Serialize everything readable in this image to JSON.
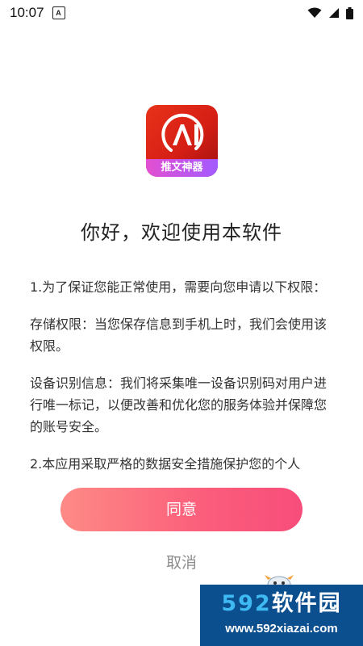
{
  "status_bar": {
    "time": "10:07",
    "notification_icon": "a-icon",
    "icons": [
      "wifi-icon",
      "signal-icon",
      "battery-icon"
    ]
  },
  "app": {
    "logo_text": "AI",
    "logo_label": "推文神器",
    "colors": {
      "logo_red": "#d61f15",
      "label_purple": "#a25bff"
    }
  },
  "dialog": {
    "title": "你好，欢迎使用本软件",
    "paragraphs": [
      "1.为了保证您能正常使用，需要向您申请以下权限：",
      "存储权限：当您保存信息到手机上时，我们会使用该权限。",
      "设备识别信息：我们将采集唯一设备识别码对用户进行唯一标记，以便改善和优化您的服务体验并保障您的账号安全。",
      "2.本应用采取严格的数据安全措施保护您的个人"
    ],
    "agree_label": "同意",
    "cancel_label": "取消",
    "colors": {
      "button_start": "#fd8b86",
      "button_end": "#f74d7b",
      "cancel_text": "#8e8e8e"
    }
  },
  "watermark": {
    "number": "592",
    "brand": "软件园",
    "url": "www.592xiazai.com"
  }
}
